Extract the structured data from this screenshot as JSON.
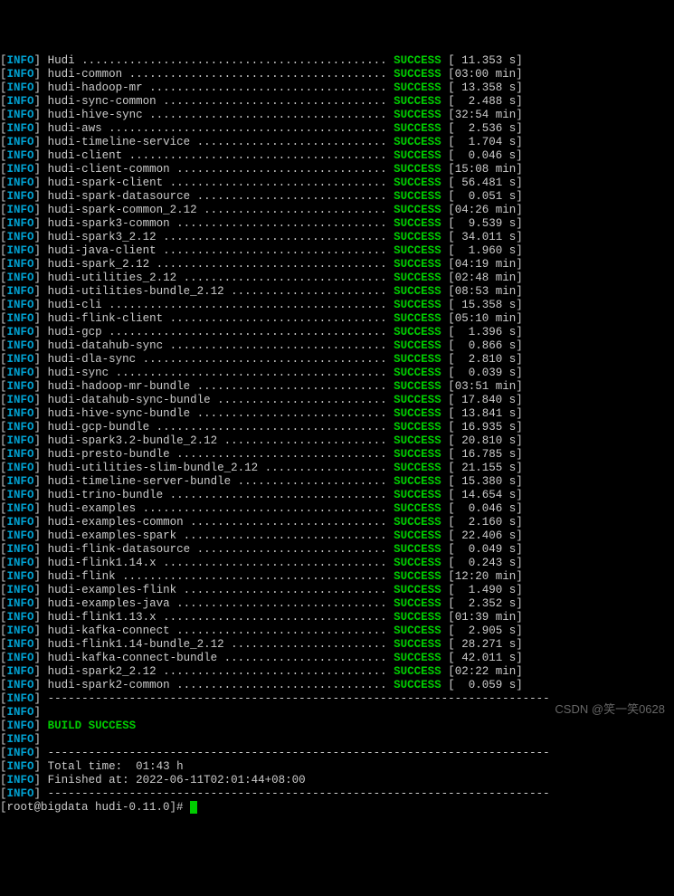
{
  "prefix": "INFO",
  "status_label": "SUCCESS",
  "build_success": "BUILD SUCCESS",
  "total_time_label": "Total time:",
  "total_time_value": "01:43 h",
  "finished_label": "Finished at:",
  "finished_value": "2022-06-11T02:01:44+08:00",
  "prompt": "[root@bigdata hudi-0.11.0]# ",
  "watermark": "CSDN @笑一笑0628",
  "top_partial": {
    "module": "Hudi",
    "time": "[ 11.353 s]"
  },
  "modules": [
    {
      "name": "hudi-common",
      "time": "[03:00 min]"
    },
    {
      "name": "hudi-hadoop-mr",
      "time": "[ 13.358 s]"
    },
    {
      "name": "hudi-sync-common",
      "time": "[  2.488 s]"
    },
    {
      "name": "hudi-hive-sync",
      "time": "[32:54 min]"
    },
    {
      "name": "hudi-aws",
      "time": "[  2.536 s]"
    },
    {
      "name": "hudi-timeline-service",
      "time": "[  1.704 s]"
    },
    {
      "name": "hudi-client",
      "time": "[  0.046 s]"
    },
    {
      "name": "hudi-client-common",
      "time": "[15:08 min]"
    },
    {
      "name": "hudi-spark-client",
      "time": "[ 56.481 s]"
    },
    {
      "name": "hudi-spark-datasource",
      "time": "[  0.051 s]"
    },
    {
      "name": "hudi-spark-common_2.12",
      "time": "[04:26 min]"
    },
    {
      "name": "hudi-spark3-common",
      "time": "[  9.539 s]"
    },
    {
      "name": "hudi-spark3_2.12",
      "time": "[ 34.011 s]"
    },
    {
      "name": "hudi-java-client",
      "time": "[  1.960 s]"
    },
    {
      "name": "hudi-spark_2.12",
      "time": "[04:19 min]"
    },
    {
      "name": "hudi-utilities_2.12",
      "time": "[02:48 min]"
    },
    {
      "name": "hudi-utilities-bundle_2.12",
      "time": "[08:53 min]"
    },
    {
      "name": "hudi-cli",
      "time": "[ 15.358 s]"
    },
    {
      "name": "hudi-flink-client",
      "time": "[05:10 min]"
    },
    {
      "name": "hudi-gcp",
      "time": "[  1.396 s]"
    },
    {
      "name": "hudi-datahub-sync",
      "time": "[  0.866 s]"
    },
    {
      "name": "hudi-dla-sync",
      "time": "[  2.810 s]"
    },
    {
      "name": "hudi-sync",
      "time": "[  0.039 s]"
    },
    {
      "name": "hudi-hadoop-mr-bundle",
      "time": "[03:51 min]"
    },
    {
      "name": "hudi-datahub-sync-bundle",
      "time": "[ 17.840 s]"
    },
    {
      "name": "hudi-hive-sync-bundle",
      "time": "[ 13.841 s]"
    },
    {
      "name": "hudi-gcp-bundle",
      "time": "[ 16.935 s]"
    },
    {
      "name": "hudi-spark3.2-bundle_2.12",
      "time": "[ 20.810 s]"
    },
    {
      "name": "hudi-presto-bundle",
      "time": "[ 16.785 s]"
    },
    {
      "name": "hudi-utilities-slim-bundle_2.12",
      "time": "[ 21.155 s]"
    },
    {
      "name": "hudi-timeline-server-bundle",
      "time": "[ 15.380 s]"
    },
    {
      "name": "hudi-trino-bundle",
      "time": "[ 14.654 s]"
    },
    {
      "name": "hudi-examples",
      "time": "[  0.046 s]"
    },
    {
      "name": "hudi-examples-common",
      "time": "[  2.160 s]"
    },
    {
      "name": "hudi-examples-spark",
      "time": "[ 22.406 s]"
    },
    {
      "name": "hudi-flink-datasource",
      "time": "[  0.049 s]"
    },
    {
      "name": "hudi-flink1.14.x",
      "time": "[  0.243 s]"
    },
    {
      "name": "hudi-flink",
      "time": "[12:20 min]"
    },
    {
      "name": "hudi-examples-flink",
      "time": "[  1.490 s]"
    },
    {
      "name": "hudi-examples-java",
      "time": "[  2.352 s]"
    },
    {
      "name": "hudi-flink1.13.x",
      "time": "[01:39 min]"
    },
    {
      "name": "hudi-kafka-connect",
      "time": "[  2.905 s]"
    },
    {
      "name": "hudi-flink1.14-bundle_2.12",
      "time": "[ 28.271 s]"
    },
    {
      "name": "hudi-kafka-connect-bundle",
      "time": "[ 42.011 s]"
    },
    {
      "name": "hudi-spark2_2.12",
      "time": "[02:22 min]"
    },
    {
      "name": "hudi-spark2-common",
      "time": "[  0.059 s]"
    }
  ]
}
